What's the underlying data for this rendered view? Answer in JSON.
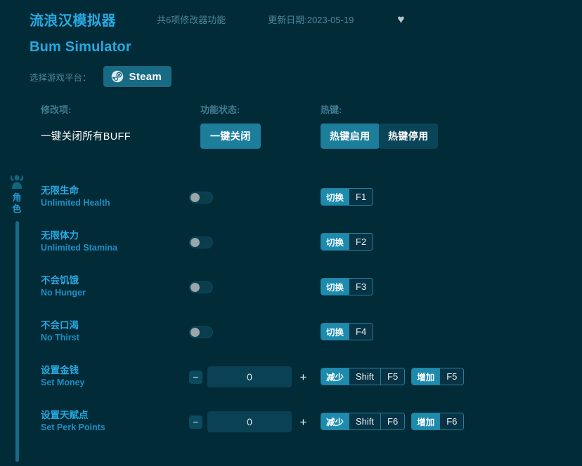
{
  "header": {
    "title_cn": "流浪汉模拟器",
    "title_en": "Bum Simulator",
    "feature_count": "共6项修改器功能",
    "update_date": "更新日期:2023-05-19",
    "favorite_icon": "♥"
  },
  "platform": {
    "label": "选择游戏平台：",
    "selected": "Steam"
  },
  "columns": {
    "mod": "修改项:",
    "status": "功能状态:",
    "hotkey": "热键:"
  },
  "master": {
    "label": "一键关闭所有BUFF",
    "close_all": "一键关闭",
    "hotkey_enable": "热键启用",
    "hotkey_disable": "热键停用"
  },
  "sidebar": {
    "category_label": "角色"
  },
  "rows": [
    {
      "cn": "无限生命",
      "en": "Unlimited Health",
      "control": "toggle",
      "toggle_on": false,
      "hotkeys": [
        {
          "action": "切换",
          "key": "F1"
        }
      ]
    },
    {
      "cn": "无限体力",
      "en": "Unlimited Stamina",
      "control": "toggle",
      "toggle_on": false,
      "hotkeys": [
        {
          "action": "切换",
          "key": "F2"
        }
      ]
    },
    {
      "cn": "不会饥饿",
      "en": "No Hunger",
      "control": "toggle",
      "toggle_on": false,
      "hotkeys": [
        {
          "action": "切换",
          "key": "F3"
        }
      ]
    },
    {
      "cn": "不会口渴",
      "en": "No Thirst",
      "control": "toggle",
      "toggle_on": false,
      "hotkeys": [
        {
          "action": "切换",
          "key": "F4"
        }
      ]
    },
    {
      "cn": "设置金钱",
      "en": "Set Money",
      "control": "stepper",
      "value": "0",
      "minus": "−",
      "plus": "+",
      "hotkeys": [
        {
          "action": "减少",
          "key": "Shift",
          "key2": "F5"
        },
        {
          "action": "增加",
          "key": "F5"
        }
      ]
    },
    {
      "cn": "设置天赋点",
      "en": "Set Perk Points",
      "control": "stepper",
      "value": "0",
      "minus": "−",
      "plus": "+",
      "hotkeys": [
        {
          "action": "减少",
          "key": "Shift",
          "key2": "F6"
        },
        {
          "action": "增加",
          "key": "F6"
        }
      ]
    }
  ],
  "colors": {
    "background": "#022b38",
    "accent_cyan": "#27a9e1",
    "button_teal": "#1d7e9b",
    "muted_label": "#4d8799"
  }
}
